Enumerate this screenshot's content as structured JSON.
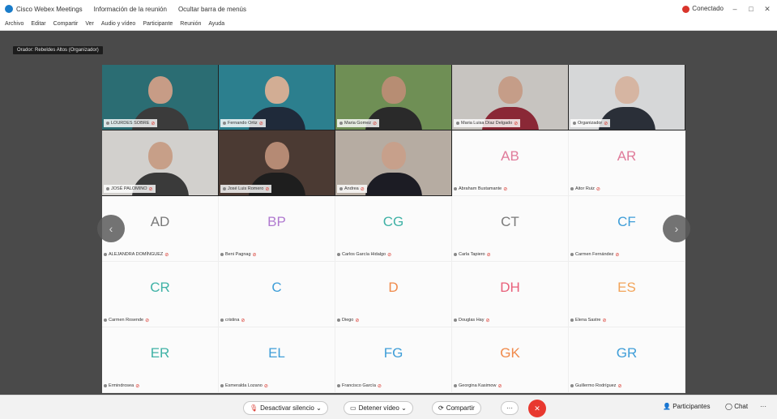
{
  "titlebar": {
    "app": "Cisco Webex Meetings",
    "meeting_info": "Información de la reunión",
    "layout": "Ocultar barra de menús",
    "connection": "Conectado",
    "controls": [
      "–",
      "□",
      "✕"
    ]
  },
  "menu": [
    "Archivo",
    "Editar",
    "Compartir",
    "Ver",
    "Audio y vídeo",
    "Participante",
    "Reunión",
    "Ayuda"
  ],
  "speaker_label": "Orador: Rebeldes Altos (Organizador)",
  "participants": [
    {
      "name": "LOURDES SOBRE",
      "type": "video",
      "bg": "#2b6d73",
      "skin": "#c79c86",
      "shirt": "#3b3b3b"
    },
    {
      "name": "Fernando Ortiz",
      "type": "video",
      "bg": "#2c7f8e",
      "skin": "#d2ad94",
      "shirt": "#1f2a3a"
    },
    {
      "name": "Maria Gomez",
      "type": "video",
      "bg": "#6f8f55",
      "skin": "#b78d73",
      "shirt": "#2a2a2a"
    },
    {
      "name": "Maria Luisa Díaz Delgado",
      "type": "video",
      "bg": "#c7c4c0",
      "skin": "#c59d88",
      "shirt": "#8a2836"
    },
    {
      "name": "Organizador",
      "type": "video",
      "bg": "#d6d7d8",
      "skin": "#d6b5a2",
      "shirt": "#2a2f38"
    },
    {
      "name": "JOSÉ PALOMINO",
      "type": "video",
      "bg": "#d2d0cd",
      "skin": "#c79f88",
      "shirt": "#3a3a3a"
    },
    {
      "name": "José Luis Romero",
      "type": "video",
      "bg": "#4b3a33",
      "skin": "#b58a74",
      "shirt": "#1e1e1e"
    },
    {
      "name": "Andrea",
      "type": "video",
      "bg": "#b6aca2",
      "skin": "#c7a08b",
      "shirt": "#1c1c24"
    },
    {
      "name": "Abraham Bustamante",
      "type": "avatar",
      "initials": "AB",
      "color": "#e07b9a"
    },
    {
      "name": "Aitor Ruiz",
      "type": "avatar",
      "initials": "AR",
      "color": "#e07b9a"
    },
    {
      "name": "ALEJANDRA DOMÍNGUEZ",
      "type": "avatar",
      "initials": "AD",
      "color": "#7a7a7a"
    },
    {
      "name": "Beni Pagnag",
      "type": "avatar",
      "initials": "BP",
      "color": "#b07ad0"
    },
    {
      "name": "Carlos García Hidalgo",
      "type": "avatar",
      "initials": "CG",
      "color": "#3fb2a6"
    },
    {
      "name": "Carla Tapiero",
      "type": "avatar",
      "initials": "CT",
      "color": "#7a7a7a"
    },
    {
      "name": "Carmen Fernández",
      "type": "avatar",
      "initials": "CF",
      "color": "#3f9ed8"
    },
    {
      "name": "Carmen Rosende",
      "type": "avatar",
      "initials": "CR",
      "color": "#3fb2a6"
    },
    {
      "name": "cristina",
      "type": "avatar",
      "initials": "C",
      "color": "#3f9ed8"
    },
    {
      "name": "Diego",
      "type": "avatar",
      "initials": "D",
      "color": "#f08a4b"
    },
    {
      "name": "Douglas Hay",
      "type": "avatar",
      "initials": "DH",
      "color": "#e8607a"
    },
    {
      "name": "Elena Sastre",
      "type": "avatar",
      "initials": "ES",
      "color": "#f2a45a"
    },
    {
      "name": "Ermindrosea",
      "type": "avatar",
      "initials": "ER",
      "color": "#3fb2a6"
    },
    {
      "name": "Esmeralda Lozano",
      "type": "avatar",
      "initials": "EL",
      "color": "#3f9ed8"
    },
    {
      "name": "Francisco García",
      "type": "avatar",
      "initials": "FG",
      "color": "#3f9ed8"
    },
    {
      "name": "Georgina Kasimow",
      "type": "avatar",
      "initials": "GK",
      "color": "#f08a4b"
    },
    {
      "name": "Guillermo Rodríguez",
      "type": "avatar",
      "initials": "GR",
      "color": "#3f9ed8"
    }
  ],
  "toolbar": {
    "mute_label": "Desactivar silencio",
    "video_label": "Detener vídeo",
    "share_label": "Compartir",
    "more_label": "···",
    "end_label": "✕",
    "participants_label": "Participantes",
    "chat_label": "Chat",
    "overflow_label": "···"
  },
  "nav": {
    "prev": "‹",
    "next": "›"
  }
}
